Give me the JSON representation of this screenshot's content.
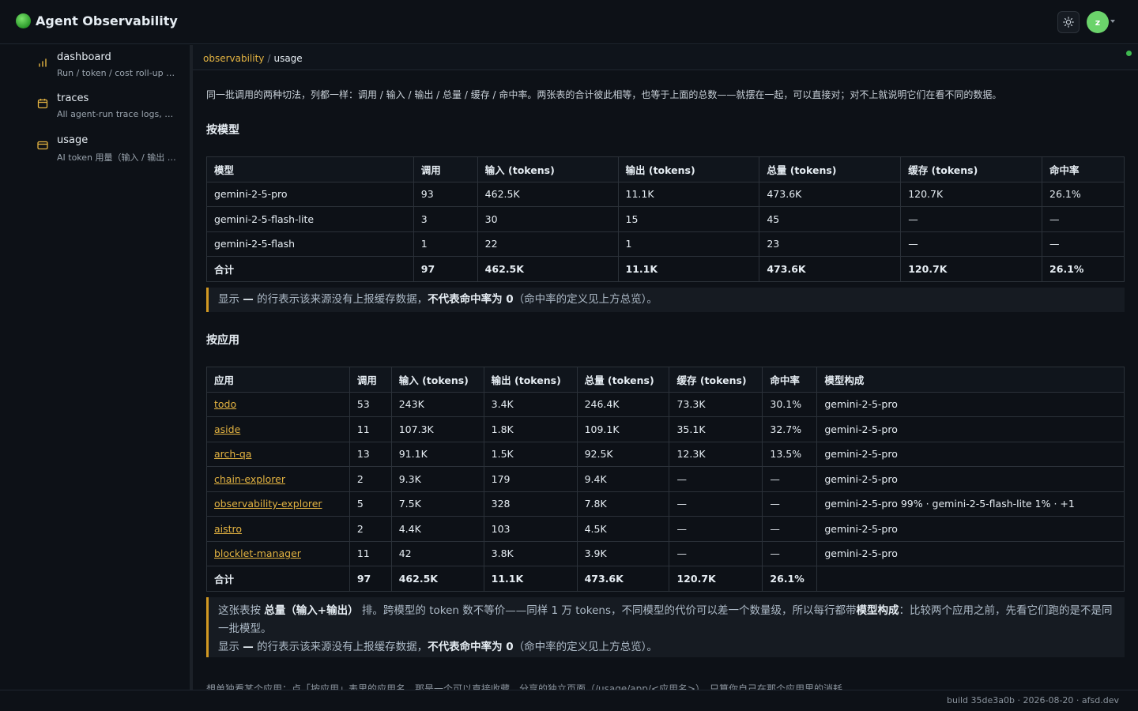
{
  "app": {
    "title": "Agent Observability",
    "avatar_initial": "z"
  },
  "colors": {
    "accent": "#e3b341",
    "brand_green": "#6bd36b",
    "status_ok": "#3fb950"
  },
  "sidebar": {
    "items": [
      {
        "title": "dashboard",
        "desc": "Run / token / cost roll-up a...",
        "icon": "bar-chart-icon"
      },
      {
        "title": "traces",
        "desc": "All agent-run trace logs, ne...",
        "icon": "calendar-icon"
      },
      {
        "title": "usage",
        "desc": "AI token 用量（输入 / 输出 /...",
        "icon": "card-icon"
      }
    ]
  },
  "breadcrumb": {
    "root": "observability",
    "separator": "/",
    "current": "usage"
  },
  "intro": "同一批调用的两种切法，列都一样：调用 / 输入 / 输出 / 总量 / 缓存 / 命中率。两张表的合计彼此相等，也等于上面的总数——就摆在一起，可以直接对；对不上就说明它们在看不同的数据。",
  "by_model": {
    "title": "按模型",
    "headers": [
      "模型",
      "调用",
      "输入 (tokens)",
      "输出 (tokens)",
      "总量 (tokens)",
      "缓存 (tokens)",
      "命中率"
    ],
    "rows": [
      [
        "gemini-2-5-pro",
        "93",
        "462.5K",
        "11.1K",
        "473.6K",
        "120.7K",
        "26.1%"
      ],
      [
        "gemini-2-5-flash-lite",
        "3",
        "30",
        "15",
        "45",
        "—",
        "—"
      ],
      [
        "gemini-2-5-flash",
        "1",
        "22",
        "1",
        "23",
        "—",
        "—"
      ]
    ],
    "total": [
      "合计",
      "97",
      "462.5K",
      "11.1K",
      "473.6K",
      "120.7K",
      "26.1%"
    ],
    "note": {
      "p1": "显示 ",
      "b1": "—",
      "p2": " 的行表示该来源没有上报缓存数据，",
      "b2": "不代表命中率为 0",
      "p3": "（命中率的定义见上方总览）。"
    }
  },
  "by_app": {
    "title": "按应用",
    "headers": [
      "应用",
      "调用",
      "输入 (tokens)",
      "输出 (tokens)",
      "总量 (tokens)",
      "缓存 (tokens)",
      "命中率",
      "模型构成"
    ],
    "rows": [
      [
        "todo",
        "53",
        "243K",
        "3.4K",
        "246.4K",
        "73.3K",
        "30.1%",
        "gemini-2-5-pro"
      ],
      [
        "aside",
        "11",
        "107.3K",
        "1.8K",
        "109.1K",
        "35.1K",
        "32.7%",
        "gemini-2-5-pro"
      ],
      [
        "arch-qa",
        "13",
        "91.1K",
        "1.5K",
        "92.5K",
        "12.3K",
        "13.5%",
        "gemini-2-5-pro"
      ],
      [
        "chain-explorer",
        "2",
        "9.3K",
        "179",
        "9.4K",
        "—",
        "—",
        "gemini-2-5-pro"
      ],
      [
        "observability-explorer",
        "5",
        "7.5K",
        "328",
        "7.8K",
        "—",
        "—",
        "gemini-2-5-pro 99% · gemini-2-5-flash-lite 1% · +1"
      ],
      [
        "aistro",
        "2",
        "4.4K",
        "103",
        "4.5K",
        "—",
        "—",
        "gemini-2-5-pro"
      ],
      [
        "blocklet-manager",
        "11",
        "42",
        "3.8K",
        "3.9K",
        "—",
        "—",
        "gemini-2-5-pro"
      ]
    ],
    "total": [
      "合计",
      "97",
      "462.5K",
      "11.1K",
      "473.6K",
      "120.7K",
      "26.1%",
      ""
    ],
    "note": {
      "p1": "这张表按 ",
      "b1": "总量（输入+输出）",
      "p2": " 排。跨模型的 token 数不等价——同样 1 万 tokens，不同模型的代价可以差一个数量级，所以每行都带",
      "b2": "模型构成",
      "p3": "：比较两个应用之前，先看它们跑的是不是同一批模型。",
      "p4": "显示 ",
      "b3": "—",
      "p5": " 的行表示该来源没有上报缓存数据，",
      "b4": "不代表命中率为 0",
      "p6": "（命中率的定义见上方总览）。"
    }
  },
  "bottom_text": "想单独看某个应用：点「按应用」表里的应用名，那是一个可以直接收藏、分享的独立页面（/usage/app/<应用名>），只算你自己在那个应用里的消耗。",
  "footer": "build 35de3a0b · 2026-08-20 · afsd.dev"
}
